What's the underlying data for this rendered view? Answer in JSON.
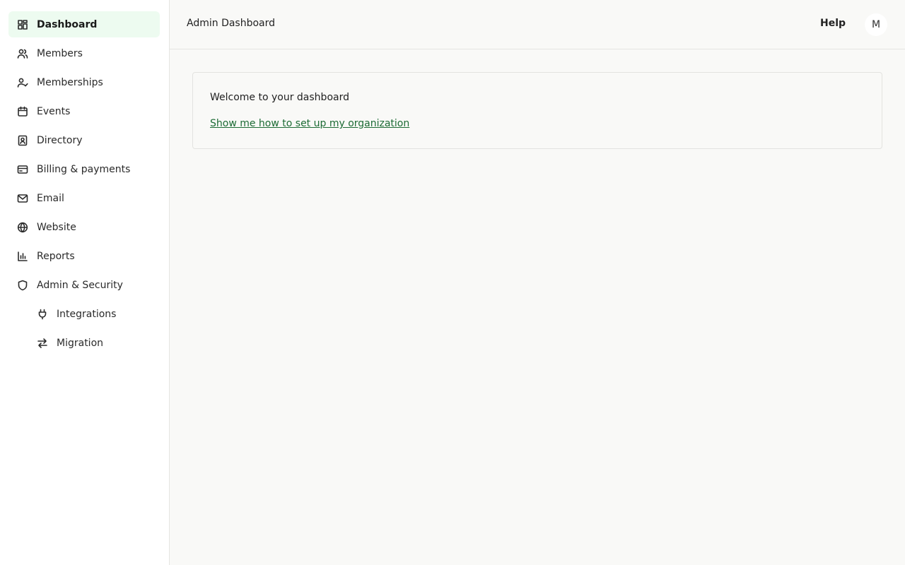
{
  "sidebar": {
    "items": [
      {
        "label": "Dashboard",
        "icon": "dashboard-icon",
        "active": true
      },
      {
        "label": "Members",
        "icon": "members-icon"
      },
      {
        "label": "Memberships",
        "icon": "memberships-icon"
      },
      {
        "label": "Events",
        "icon": "calendar-icon"
      },
      {
        "label": "Directory",
        "icon": "directory-icon"
      },
      {
        "label": "Billing & payments",
        "icon": "credit-card-icon"
      },
      {
        "label": "Email",
        "icon": "mail-icon"
      },
      {
        "label": "Website",
        "icon": "globe-icon"
      },
      {
        "label": "Reports",
        "icon": "bar-chart-icon"
      },
      {
        "label": "Admin & Security",
        "icon": "shield-icon"
      },
      {
        "label": "Integrations",
        "icon": "plug-icon"
      },
      {
        "label": "Migration",
        "icon": "arrows-swap-icon"
      }
    ]
  },
  "header": {
    "title": "Admin Dashboard",
    "help_label": "Help",
    "avatar_initial": "M"
  },
  "main": {
    "welcome_card": {
      "title": "Welcome to your dashboard",
      "link_text": "Show me how to set up my organization"
    }
  },
  "colors": {
    "accent_link": "#1c6b34",
    "active_nav_bg": "#edfbf0",
    "page_bg": "#f9f9f7"
  }
}
